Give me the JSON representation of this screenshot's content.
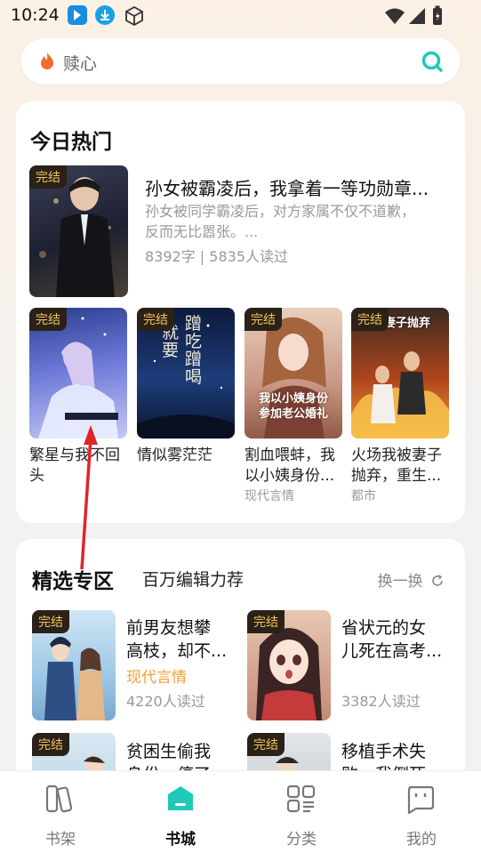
{
  "status": {
    "time": "10:24"
  },
  "search": {
    "placeholder": "赎心"
  },
  "hot": {
    "title": "今日热门",
    "badge": "完结",
    "featured": {
      "title": "孙女被霸凌后，我拿着一等功勋章...",
      "desc_line1": "孙女被同学霸凌后，对方家属不仅不道歉，",
      "desc_line2": "反而无比嚣张。...",
      "meta": "8392字 | 5835人读过"
    },
    "grid": [
      {
        "title_l1": "繁星与我不回",
        "title_l2": "头",
        "sub": ""
      },
      {
        "title_l1": "情似雾茫茫",
        "title_l2": "",
        "sub": ""
      },
      {
        "title_l1": "割血喂蚌，我",
        "title_l2": "以小姨身份...",
        "sub": "现代言情",
        "cover_text_1": "我以小姨身份",
        "cover_text_2": "参加老公婚礼"
      },
      {
        "title_l1": "火场我被妻子",
        "title_l2": "抛弃，重生...",
        "sub": "都市",
        "cover_text_1": "被妻子抛弃"
      }
    ],
    "cover2_text": [
      "蹭吃",
      "蹭喝",
      "就要"
    ]
  },
  "featured_section": {
    "title": "精选专区",
    "subtitle": "百万编辑力荐",
    "refresh": "换一换",
    "badge": "完结",
    "books": [
      {
        "l1": "前男友想攀",
        "l2": "高枝，却不...",
        "genre": "现代言情",
        "reads": "4220人读过"
      },
      {
        "l1": "省状元的女",
        "l2": "儿死在高考...",
        "genre": "",
        "reads": "3382人读过"
      },
      {
        "l1": "贫困生偷我",
        "l2": "身份，停了...",
        "genre": "",
        "reads": ""
      },
      {
        "l1": "移植手术失",
        "l2": "败，我倒死...",
        "genre": "",
        "reads": ""
      }
    ]
  },
  "tabs": [
    {
      "label": "书架",
      "icon": "bookshelf-icon"
    },
    {
      "label": "书城",
      "icon": "bookstore-icon",
      "active": true
    },
    {
      "label": "分类",
      "icon": "category-icon"
    },
    {
      "label": "我的",
      "icon": "profile-icon"
    }
  ],
  "colors": {
    "accent": "#1fc9b7",
    "badge_bg": "#2a2118",
    "badge_text": "#f3c35a",
    "genre": "#f0a23a"
  }
}
